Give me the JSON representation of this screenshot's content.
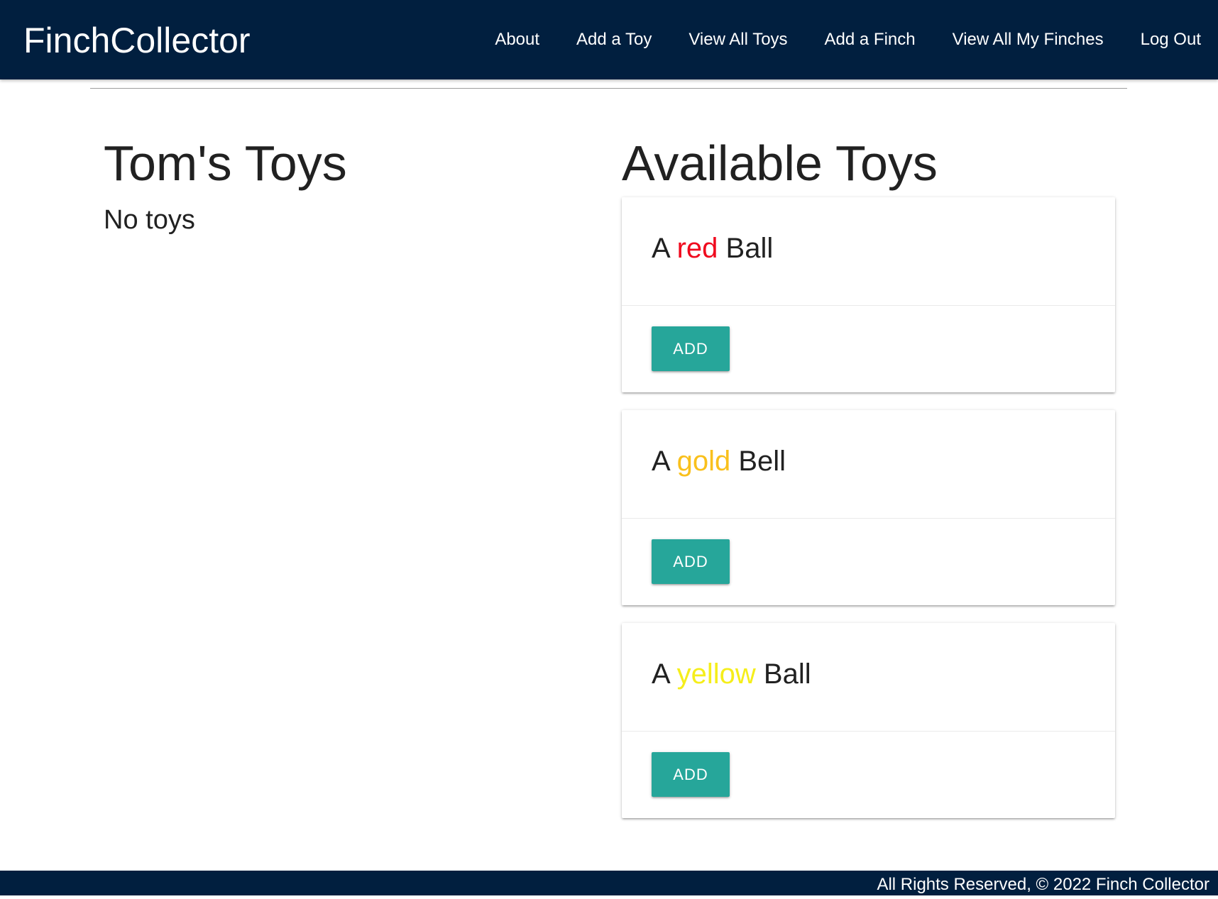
{
  "header": {
    "brand": "FinchCollector",
    "nav": [
      {
        "label": "About"
      },
      {
        "label": "Add a Toy"
      },
      {
        "label": "View All Toys"
      },
      {
        "label": "Add a Finch"
      },
      {
        "label": "View All My Finches"
      },
      {
        "label": "Log Out"
      }
    ],
    "background_color": "#011f3f"
  },
  "finch_toys": {
    "title": "Tom's Toys",
    "empty_text": "No toys"
  },
  "available_toys": {
    "title": "Available Toys",
    "items": [
      {
        "prefix": "A",
        "color_word": "red",
        "color_hex": "#f00a1e",
        "name": "Ball",
        "button": "ADD"
      },
      {
        "prefix": "A",
        "color_word": "gold",
        "color_hex": "#f9c01c",
        "name": "Bell",
        "button": "ADD"
      },
      {
        "prefix": "A",
        "color_word": "yellow",
        "color_hex": "#f5ee1b",
        "name": "Ball",
        "button": "ADD"
      }
    ],
    "button_color": "#26a69a"
  },
  "footer": {
    "text": "All Rights Reserved, © 2022 Finch Collector"
  }
}
